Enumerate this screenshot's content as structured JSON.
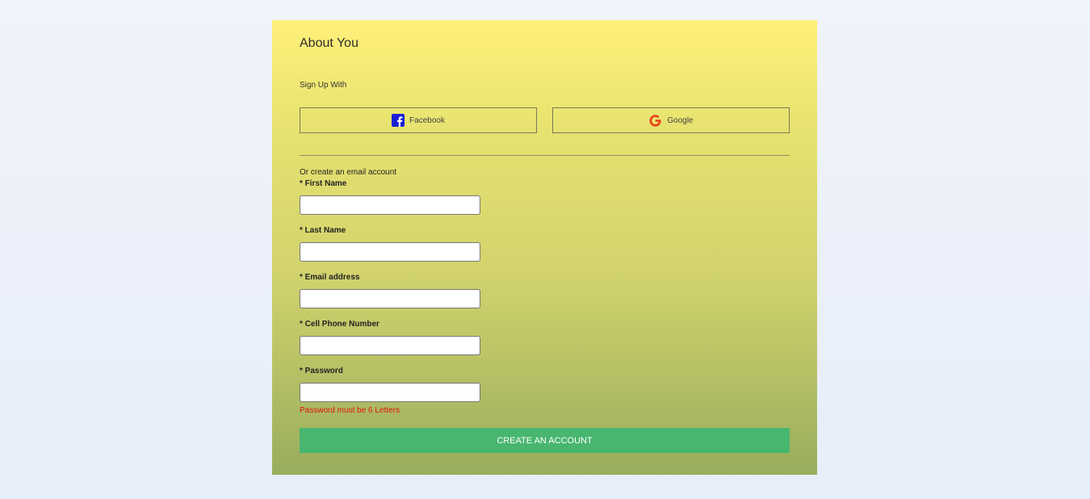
{
  "form": {
    "title": "About You",
    "signup_with": "Sign Up With",
    "social": {
      "facebook_label": "Facebook",
      "google_label": "Google",
      "facebook_icon": "facebook-icon",
      "google_icon": "google-icon"
    },
    "or_text": "Or create an email account",
    "fields": [
      {
        "label": "* First Name",
        "value": "",
        "placeholder": ""
      },
      {
        "label": "* Last Name",
        "value": "",
        "placeholder": ""
      },
      {
        "label": "* Email address",
        "value": "",
        "placeholder": ""
      },
      {
        "label": "* Cell Phone Number",
        "value": "",
        "placeholder": ""
      },
      {
        "label": "* Password",
        "value": "",
        "placeholder": ""
      }
    ],
    "password_error": "Password must be 6 Letters",
    "submit_label": "CREATE AN ACCOUNT"
  },
  "colors": {
    "card_top": "#fff07a",
    "card_bottom": "#98ad5d",
    "submit_bg": "#48b66f",
    "error": "#e01010",
    "facebook_blue": "#1a1fd6",
    "google_red": "#e8421a"
  }
}
